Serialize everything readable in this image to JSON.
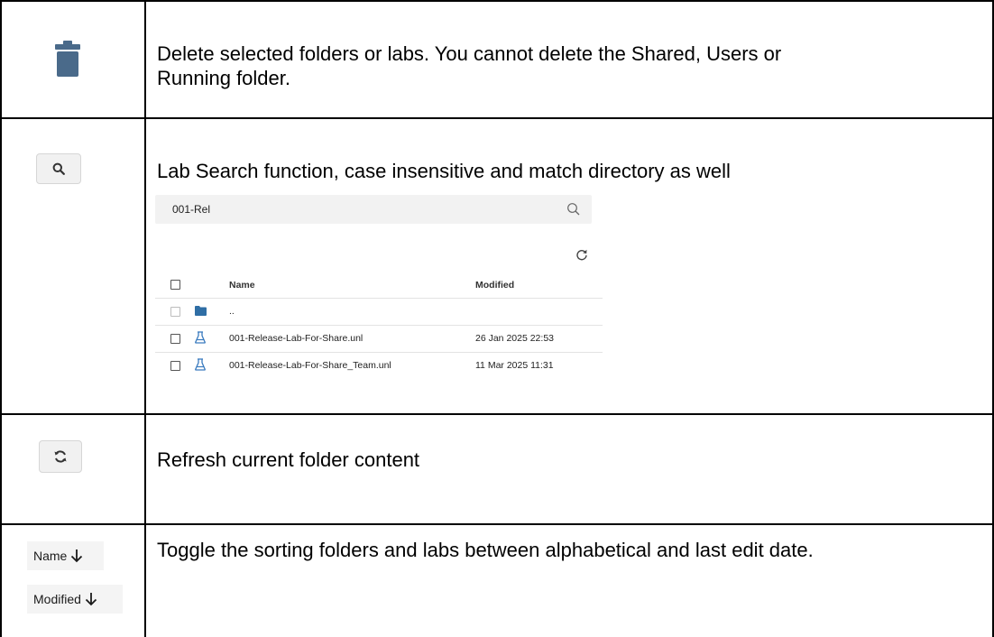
{
  "rows": [
    {
      "icon": "trash-icon",
      "description": "Delete selected folders or labs. You cannot delete the Shared, Users or Running folder."
    },
    {
      "icon": "search-icon",
      "description": "Lab Search function, case insensitive and match directory as well"
    },
    {
      "icon": "refresh-icon",
      "description": "Refresh current folder content"
    },
    {
      "icon": "sort-icon",
      "description": "Toggle the sorting folders and labs between alphabetical and last edit date."
    }
  ],
  "row1_lines": [
    "Delete selected folders or labs. You cannot delete the Shared, Users or",
    "Running folder."
  ],
  "search_example": {
    "query": "001-Rel",
    "columns": {
      "name": "Name",
      "modified": "Modified"
    },
    "parent_label": "..",
    "items": [
      {
        "name": "001-Release-Lab-For-Share.unl",
        "modified": "26 Jan 2025 22:53"
      },
      {
        "name": "001-Release-Lab-For-Share_Team.unl",
        "modified": "11 Mar 2025 11:31"
      }
    ]
  },
  "sort_buttons": {
    "name_label": "Name",
    "modified_label": "Modified"
  },
  "colors": {
    "icon_blue": "#4a6a8a",
    "lab_blue": "#3a7bbf",
    "folder_blue": "#2f6ea5"
  }
}
